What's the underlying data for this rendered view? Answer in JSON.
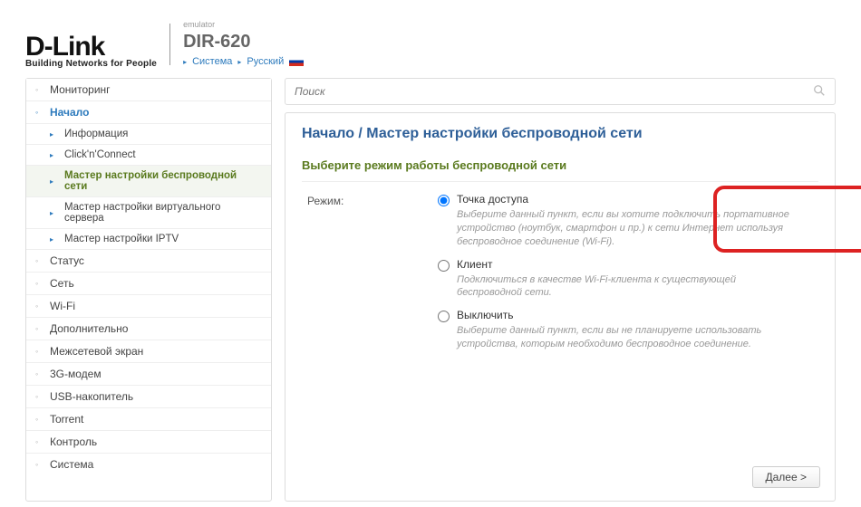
{
  "header": {
    "logo_main": "D-Link",
    "logo_sub": "Building Networks for People",
    "emulator": "emulator",
    "model": "DIR-620",
    "link_system": "Система",
    "link_lang": "Русский"
  },
  "search": {
    "placeholder": "Поиск"
  },
  "sidebar": {
    "items": [
      {
        "label": "Мониторинг",
        "sub": false,
        "active": false,
        "expand": false
      },
      {
        "label": "Начало",
        "sub": false,
        "active": true,
        "expand": true
      },
      {
        "label": "Информация",
        "sub": true,
        "active": false
      },
      {
        "label": "Click'n'Connect",
        "sub": true,
        "active": false
      },
      {
        "label": "Мастер настройки беспроводной сети",
        "sub": true,
        "active": true
      },
      {
        "label": "Мастер настройки виртуального сервера",
        "sub": true,
        "active": false
      },
      {
        "label": "Мастер настройки IPTV",
        "sub": true,
        "active": false
      },
      {
        "label": "Статус",
        "sub": false,
        "active": false
      },
      {
        "label": "Сеть",
        "sub": false,
        "active": false
      },
      {
        "label": "Wi-Fi",
        "sub": false,
        "active": false
      },
      {
        "label": "Дополнительно",
        "sub": false,
        "active": false
      },
      {
        "label": "Межсетевой экран",
        "sub": false,
        "active": false
      },
      {
        "label": "3G-модем",
        "sub": false,
        "active": false
      },
      {
        "label": "USB-накопитель",
        "sub": false,
        "active": false
      },
      {
        "label": "Torrent",
        "sub": false,
        "active": false
      },
      {
        "label": "Контроль",
        "sub": false,
        "active": false
      },
      {
        "label": "Система",
        "sub": false,
        "active": false
      }
    ]
  },
  "main": {
    "breadcrumb": "Начало /  Мастер настройки беспроводной сети",
    "section_title": "Выберите режим работы беспроводной сети",
    "mode_label": "Режим:",
    "options": [
      {
        "label": "Точка доступа",
        "desc": "Выберите данный пункт, если вы хотите подключить портативное устройство (ноутбук, смартфон и пр.) к сети Интернет используя беспроводное соединение (Wi-Fi).",
        "checked": true
      },
      {
        "label": "Клиент",
        "desc": "Подключиться в качестве Wi-Fi-клиента к существующей беспроводной сети.",
        "checked": false
      },
      {
        "label": "Выключить",
        "desc": "Выберите данный пункт, если вы не планируете использовать устройства, которым необходимо беспроводное соединение.",
        "checked": false
      }
    ],
    "next": "Далее >"
  }
}
